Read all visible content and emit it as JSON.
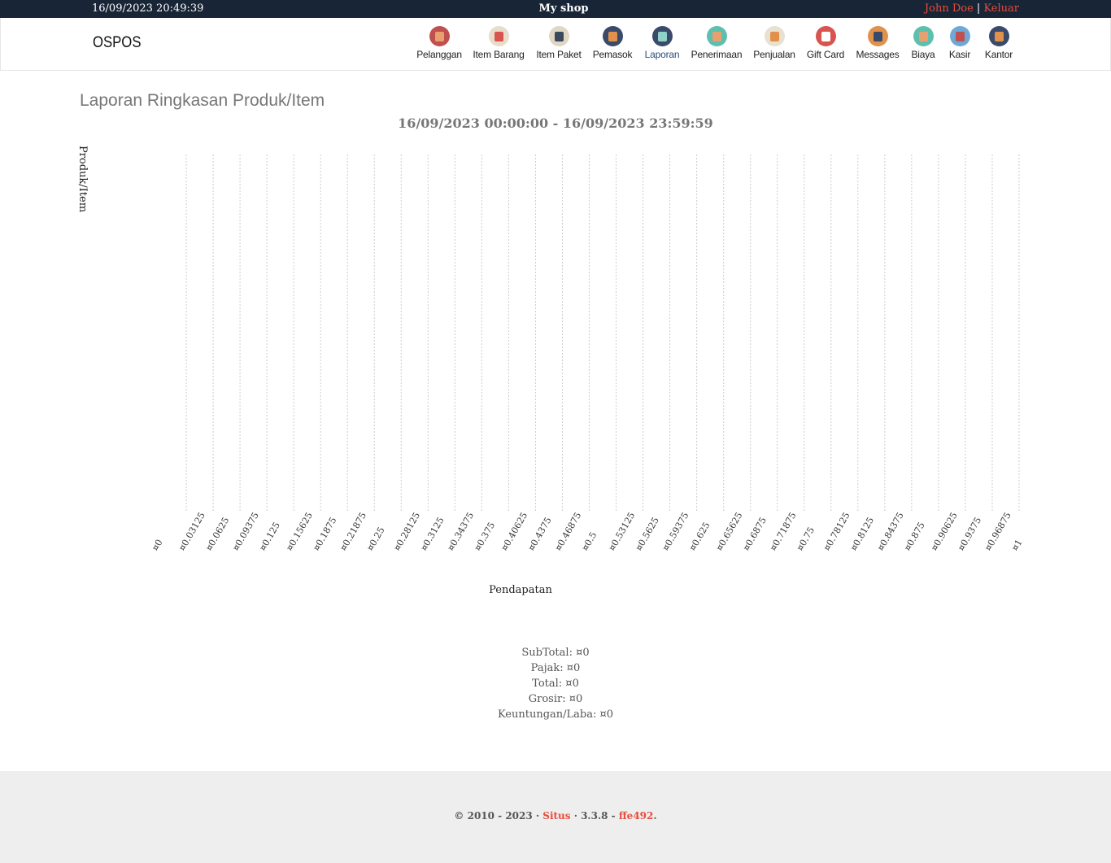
{
  "topbar": {
    "datetime": "16/09/2023 20:49:39",
    "shop_name": "My shop",
    "user_name": "John Doe",
    "separator": "|",
    "logout": "Keluar"
  },
  "brand": "OSPOS",
  "nav": [
    {
      "label": "Pelanggan",
      "icon": "customers-icon",
      "color": "#c0504d",
      "inner": "#e8a070"
    },
    {
      "label": "Item Barang",
      "icon": "items-tag-icon",
      "color": "#e8dccb",
      "inner": "#d9534f"
    },
    {
      "label": "Item Paket",
      "icon": "item-kits-stack-icon",
      "color": "#e0d6c4",
      "inner": "#3a4a5c"
    },
    {
      "label": "Pemasok",
      "icon": "suppliers-briefcase-icon",
      "color": "#3a4a6b",
      "inner": "#e2914a"
    },
    {
      "label": "Laporan",
      "icon": "reports-chart-icon",
      "color": "#3a4a6b",
      "inner": "#8fd3c8",
      "active": true
    },
    {
      "label": "Penerimaan",
      "icon": "receivings-cart-icon",
      "color": "#5fbfae",
      "inner": "#e8a070"
    },
    {
      "label": "Penjualan",
      "icon": "sales-basket-icon",
      "color": "#e8e0d0",
      "inner": "#e2914a"
    },
    {
      "label": "Gift Card",
      "icon": "giftcard-heart-icon",
      "color": "#d9534f",
      "inner": "#ffffff"
    },
    {
      "label": "Messages",
      "icon": "messages-phone-icon",
      "color": "#e2914a",
      "inner": "#3a4a6b"
    },
    {
      "label": "Biaya",
      "icon": "expenses-note-icon",
      "color": "#5fbfae",
      "inner": "#e8a070"
    },
    {
      "label": "Kasir",
      "icon": "cashups-books-icon",
      "color": "#6fa8d6",
      "inner": "#c0504d"
    },
    {
      "label": "Kantor",
      "icon": "office-door-icon",
      "color": "#3a4a6b",
      "inner": "#e2914a"
    }
  ],
  "report": {
    "title": "Laporan Ringkasan Produk/Item",
    "date_range": "16/09/2023 00:00:00 - 16/09/2023 23:59:59"
  },
  "chart_data": {
    "type": "bar",
    "orientation": "horizontal",
    "categories": [],
    "values": [],
    "xlabel": "Pendapatan",
    "ylabel": "Produk/Item",
    "xlim": [
      0,
      1
    ],
    "currency_symbol": "¤",
    "x_tick_labels": [
      "¤0",
      "¤0.03125",
      "¤0.0625",
      "¤0.09375",
      "¤0.125",
      "¤0.15625",
      "¤0.1875",
      "¤0.21875",
      "¤0.25",
      "¤0.28125",
      "¤0.3125",
      "¤0.34375",
      "¤0.375",
      "¤0.40625",
      "¤0.4375",
      "¤0.46875",
      "¤0.5",
      "¤0.53125",
      "¤0.5625",
      "¤0.59375",
      "¤0.625",
      "¤0.65625",
      "¤0.6875",
      "¤0.71875",
      "¤0.75",
      "¤0.78125",
      "¤0.8125",
      "¤0.84375",
      "¤0.875",
      "¤0.90625",
      "¤0.9375",
      "¤0.96875",
      "¤1"
    ],
    "grid": true
  },
  "summary": [
    {
      "label": "SubTotal",
      "value": "¤0"
    },
    {
      "label": "Pajak",
      "value": "¤0"
    },
    {
      "label": "Total",
      "value": "¤0"
    },
    {
      "label": "Grosir",
      "value": "¤0"
    },
    {
      "label": "Keuntungan/Laba",
      "value": "¤0"
    }
  ],
  "footer": {
    "copyright": "© 2010 - 2023 ·",
    "site_link": "Situs",
    "version": "· 3.3.8 -",
    "commit_link": "ffe492",
    "end": "."
  }
}
